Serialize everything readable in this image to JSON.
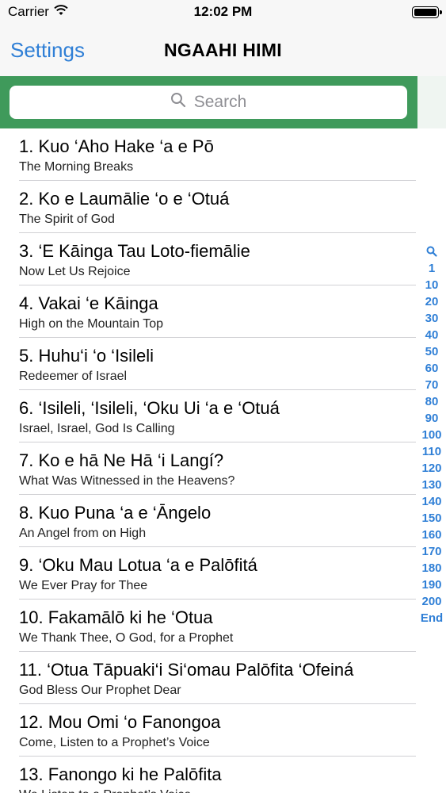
{
  "status_bar": {
    "carrier": "Carrier",
    "time": "12:02 PM",
    "battery_level": 1.0
  },
  "nav": {
    "back_label": "Settings",
    "title": "NGAAHI HIMI"
  },
  "search": {
    "placeholder": "Search"
  },
  "colors": {
    "accent": "#2f7fd6",
    "search_bar_bg": "#3f9a5b"
  },
  "hymns": [
    {
      "title": "1. Kuo ‘Aho Hake ‘a e Pō",
      "subtitle": "The Morning Breaks"
    },
    {
      "title": "2. Ko e Laumālie ‘o e ‘Otuá",
      "subtitle": "The Spirit of God"
    },
    {
      "title": "3. ‘E Kāinga Tau Loto-fiemālie",
      "subtitle": "Now Let Us Rejoice"
    },
    {
      "title": "4. Vakai ‘e Kāinga",
      "subtitle": "High on the Mountain Top"
    },
    {
      "title": "5. Huhu‘i ‘o ‘Isileli",
      "subtitle": "Redeemer of Israel"
    },
    {
      "title": "6. ‘Isileli, ‘Isileli, ‘Oku Ui ‘a e ‘Otuá",
      "subtitle": "Israel, Israel, God Is Calling"
    },
    {
      "title": "7. Ko e hā Ne Hā ‘i Langí?",
      "subtitle": "What Was Witnessed in the Heavens?"
    },
    {
      "title": "8. Kuo Puna ‘a e ‘Āngelo",
      "subtitle": "An Angel from on High"
    },
    {
      "title": "9. ‘Oku Mau Lotua ‘a e Palōfitá",
      "subtitle": "We Ever Pray for Thee"
    },
    {
      "title": "10. Fakamālō ki he ‘Otua",
      "subtitle": "We Thank Thee, O God, for a Prophet"
    },
    {
      "title": "11. ‘Otua Tāpuaki‘i Si‘omau Palōfita ‘Ofeiná",
      "subtitle": "God Bless Our Prophet Dear"
    },
    {
      "title": "12. Mou Omi ‘o Fanongoa",
      "subtitle": "Come, Listen to a Prophet’s Voice"
    },
    {
      "title": "13. Fanongo ki he Palōfita",
      "subtitle": "We Listen to a Prophet’s Voice"
    }
  ],
  "index": [
    "1",
    "10",
    "20",
    "30",
    "40",
    "50",
    "60",
    "70",
    "80",
    "90",
    "100",
    "110",
    "120",
    "130",
    "140",
    "150",
    "160",
    "170",
    "180",
    "190",
    "200",
    "End"
  ]
}
